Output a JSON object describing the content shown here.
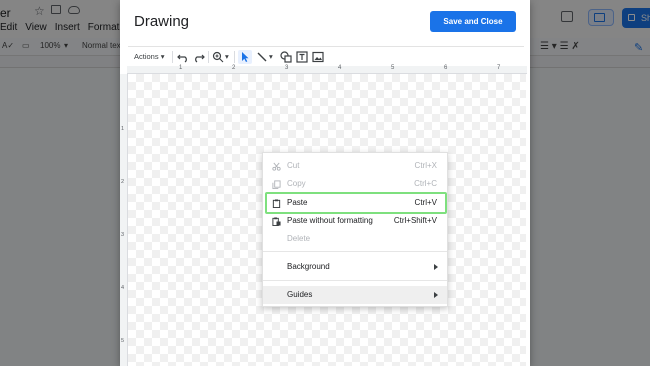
{
  "background_app": {
    "title_fragment": "er",
    "menus": [
      "Edit",
      "View",
      "Insert",
      "Format",
      "To"
    ],
    "toolbar": {
      "zoom": "100%",
      "style": "Normal text"
    },
    "share_label_fragment": "Sh"
  },
  "dialog": {
    "title": "Drawing",
    "save_button": "Save and Close",
    "toolbar": {
      "actions_label": "Actions"
    },
    "ruler_numbers_h": [
      "1",
      "2",
      "3",
      "4",
      "5",
      "6",
      "7"
    ],
    "ruler_numbers_v": [
      "1",
      "2",
      "3",
      "4",
      "5"
    ]
  },
  "context_menu": {
    "items": [
      {
        "label": "Cut",
        "shortcut": "Ctrl+X",
        "enabled": false,
        "icon": "scissors-icon"
      },
      {
        "label": "Copy",
        "shortcut": "Ctrl+C",
        "enabled": false,
        "icon": "copy-icon"
      },
      {
        "label": "Paste",
        "shortcut": "Ctrl+V",
        "enabled": true,
        "icon": "clipboard-icon",
        "highlighted": true
      },
      {
        "label": "Paste without formatting",
        "shortcut": "Ctrl+Shift+V",
        "enabled": true,
        "icon": "paste-plain-icon"
      },
      {
        "label": "Delete",
        "shortcut": "",
        "enabled": false
      },
      {
        "label": "Background",
        "enabled": true,
        "submenu": true
      },
      {
        "label": "Guides",
        "enabled": true,
        "submenu": true,
        "hovered": true
      }
    ]
  },
  "colors": {
    "accent": "#1a73e8",
    "highlight_outline": "#7ee07e",
    "overlay": "#000000"
  }
}
